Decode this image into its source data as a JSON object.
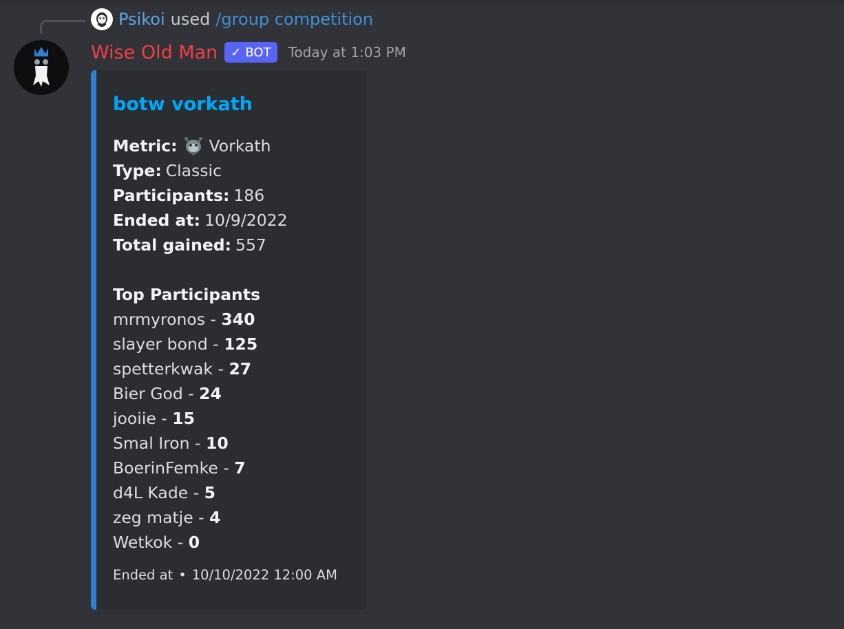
{
  "command": {
    "user": "Psikoi",
    "used_text": "used",
    "command_name": "/group competition"
  },
  "message": {
    "author": "Wise Old Man",
    "bot_tag": "BOT",
    "timestamp": "Today at 1:03 PM",
    "author_color": "#f23f42"
  },
  "embed": {
    "accent_color": "#2f7fd1",
    "title": "botw vorkath",
    "fields": [
      {
        "label": "Metric:",
        "value": "Vorkath",
        "icon": "vorkath-icon"
      },
      {
        "label": "Type:",
        "value": "Classic"
      },
      {
        "label": "Participants:",
        "value": "186"
      },
      {
        "label": "Ended at:",
        "value": "10/9/2022"
      },
      {
        "label": "Total gained:",
        "value": "557"
      }
    ],
    "top_heading": "Top Participants",
    "participants": [
      {
        "name": "mrmyronos",
        "score": "340"
      },
      {
        "name": "slayer bond",
        "score": "125"
      },
      {
        "name": "spetterkwak",
        "score": "27"
      },
      {
        "name": "Bier God",
        "score": "24"
      },
      {
        "name": "jooiie",
        "score": "15"
      },
      {
        "name": "Smal Iron",
        "score": "10"
      },
      {
        "name": "BoerinFemke",
        "score": "7"
      },
      {
        "name": "d4L Kade",
        "score": "5"
      },
      {
        "name": "zeg matje",
        "score": "4"
      },
      {
        "name": "Wetkok",
        "score": "0"
      }
    ],
    "footer": {
      "label": "Ended at",
      "value": "10/10/2022 12:00 AM"
    }
  }
}
